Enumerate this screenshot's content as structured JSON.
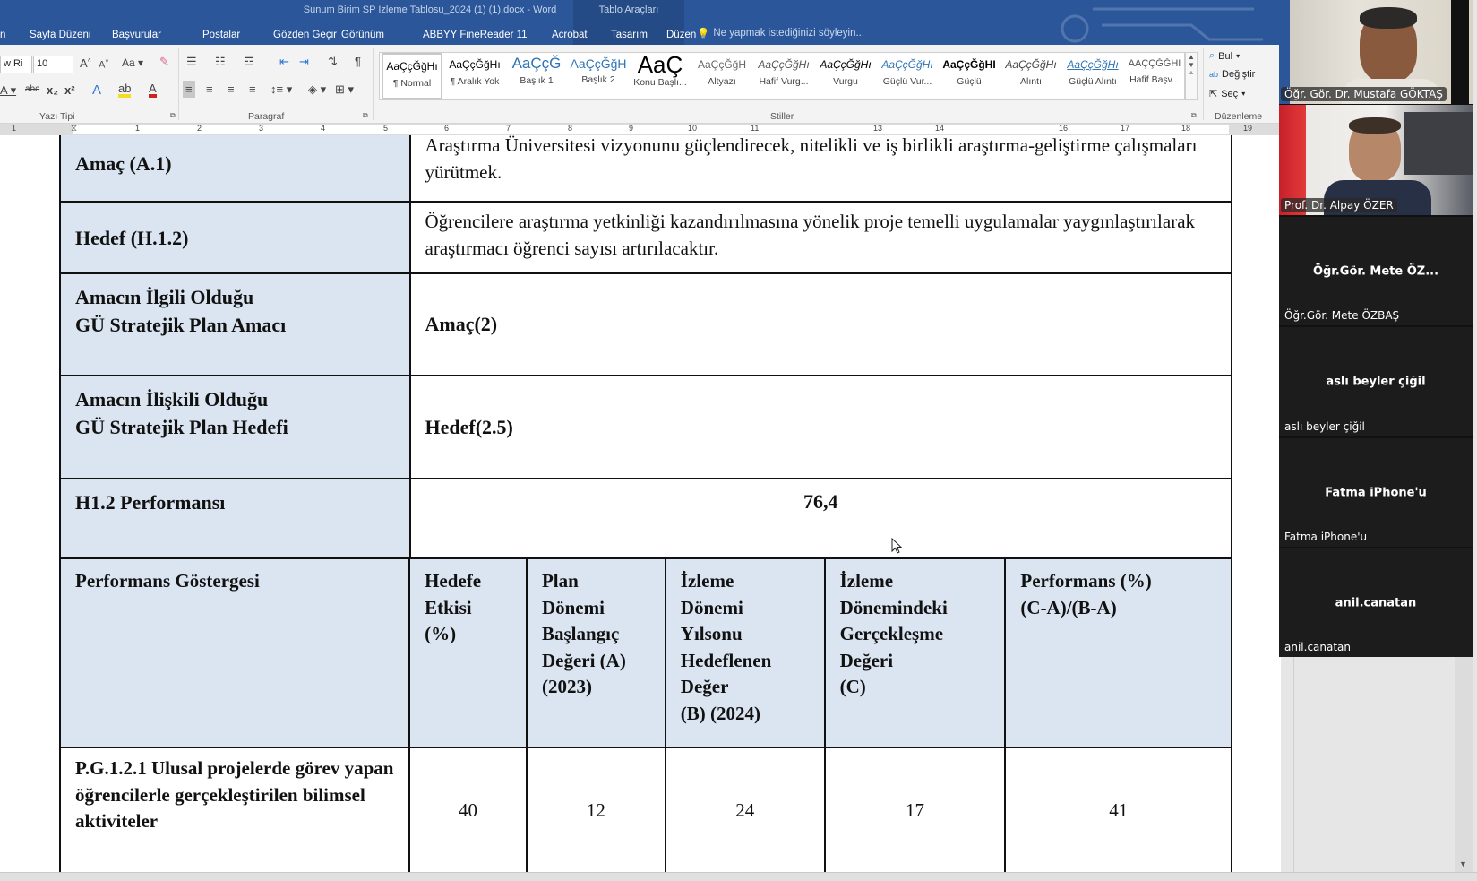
{
  "window": {
    "title": "Sunum Birim SP Izleme Tablosu_2024 (1) (1).docx - Word",
    "context_tab_group": "Tablo Araçları"
  },
  "tabs": [
    "n",
    "Sayfa Düzeni",
    "Başvurular",
    "Postalar",
    "Gözden Geçir",
    "Görünüm",
    "ABBYY FineReader 11",
    "Acrobat",
    "Tasarım",
    "Düzen"
  ],
  "tell_me": "Ne yapmak istediğinizi söyleyin...",
  "ribbon": {
    "font_name": "w Ri",
    "font_size": "10",
    "groups": {
      "font": "Yazı Tipi",
      "paragraph": "Paragraf",
      "styles": "Stiller",
      "editing": "Düzenleme"
    },
    "styles": [
      {
        "preview": "AaÇçĞğHı",
        "name": "¶ Normal",
        "selected": true
      },
      {
        "preview": "AaÇçĞğHı",
        "name": "¶ Aralık Yok"
      },
      {
        "preview": "AaÇçĞ",
        "name": "Başlık 1"
      },
      {
        "preview": "AaÇçĞğH",
        "name": "Başlık 2"
      },
      {
        "preview": "AaÇ",
        "name": "Konu Başlı..."
      },
      {
        "preview": "AaÇçĞğH",
        "name": "Altyazı"
      },
      {
        "preview": "AaÇçĞğHı",
        "name": "Hafif Vurg..."
      },
      {
        "preview": "AaÇçĞğHı",
        "name": "Vurgu"
      },
      {
        "preview": "AaÇçĞğHı",
        "name": "Güçlü Vur..."
      },
      {
        "preview": "AaÇçĞğHI",
        "name": "Güçlü"
      },
      {
        "preview": "AaÇçĞğHı",
        "name": "Alıntı"
      },
      {
        "preview": "AaÇçĞğHı",
        "name": "Güçlü Alıntı"
      },
      {
        "preview": "AAÇÇĞĞHI",
        "name": "Hafif Başv..."
      }
    ],
    "editing": {
      "find": "Bul",
      "replace": "Değiştir",
      "select": "Seç"
    }
  },
  "ruler": [
    "1",
    "1",
    "2",
    "3",
    "4",
    "5",
    "6",
    "7",
    "8",
    "9",
    "10",
    "11",
    "13",
    "14",
    "16",
    "17",
    "18",
    "19"
  ],
  "document": {
    "rows": [
      {
        "label": "Amaç (A.1)",
        "value": "Araştırma Üniversitesi vizyonunu güçlendirecek, nitelikli ve iş birlikli araştırma-geliştirme çalışmaları yürütmek."
      },
      {
        "label": "Hedef (H.1.2)",
        "value": "Öğrencilere araştırma yetkinliği kazandırılmasına yönelik proje temelli uygulamalar yaygınlaştırılarak araştırmacı öğrenci sayısı artırılacaktır."
      },
      {
        "label_line1": "Amacın İlgili Olduğu",
        "label_line2": "GÜ Stratejik Plan Amacı",
        "value": "Amaç(2)"
      },
      {
        "label_line1": "Amacın İlişkili Olduğu",
        "label_line2": "GÜ Stratejik Plan Hedefi",
        "value": "Hedef(2.5)"
      },
      {
        "label": "H1.2 Performansı",
        "value": "76,4"
      }
    ],
    "indicator_table": {
      "headers": [
        "Performans Göstergesi",
        "Hedefe Etkisi (%)",
        "Plan Dönemi Başlangıç Değeri (A) (2023)",
        "İzleme Dönemi Yılsonu Hedeflenen Değer (B) (2024)",
        "İzleme Dönemindeki Gerçekleşme Değeri (C)",
        "Performans (%) (C-A)/(B-A)"
      ],
      "header_lines": [
        [
          "Performans Göstergesi"
        ],
        [
          "Hedefe",
          "Etkisi",
          "(%)"
        ],
        [
          "Plan",
          "Dönemi",
          "Başlangıç",
          "Değeri (A)",
          "(2023)"
        ],
        [
          "İzleme",
          "Dönemi",
          "Yılsonu",
          "Hedeflenen",
          "Değer",
          "(B) (2024)"
        ],
        [
          "İzleme",
          "Dönemindeki",
          "Gerçekleşme",
          "Değeri",
          "(C)"
        ],
        [
          "Performans (%)",
          "(C-A)/(B-A)"
        ]
      ],
      "row": {
        "indicator": "P.G.1.2.1 Ulusal projelerde görev yapan öğrencilerle gerçekleştirilen bilimsel aktiviteler",
        "hedefe_etkisi": "40",
        "baslangic_A": "12",
        "hedef_B": "24",
        "gerceklesme_C": "17",
        "performans": "41"
      }
    }
  },
  "participants": [
    {
      "name": "Öğr. Gör. Dr. Mustafa GÖKTAŞ",
      "video": true
    },
    {
      "name": "Prof. Dr. Alpay ÖZER",
      "video": true
    },
    {
      "name": "Öğr.Gör. Mete ÖZBAŞ",
      "display": "Öğr.Gör. Mete ÖZ...",
      "video": false
    },
    {
      "name": "aslı beyler çiğil",
      "display": "aslı beyler çiğil",
      "video": false
    },
    {
      "name": "Fatma iPhone'u",
      "display": "Fatma iPhone'u",
      "video": false
    },
    {
      "name": "anil.canatan",
      "display": "anil.canatan",
      "video": false
    }
  ],
  "colors": {
    "titlebar": "#2b579a",
    "table_label_bg": "#dbe5f1",
    "tile_bg": "#1c1c1c"
  }
}
